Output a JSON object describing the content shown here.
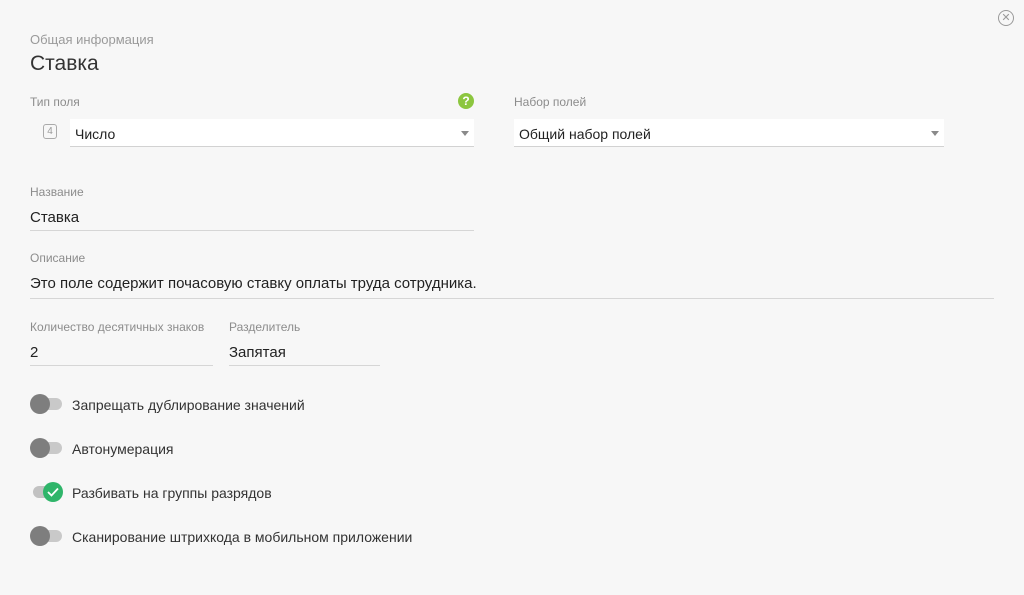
{
  "header": {
    "section_label": "Общая информация",
    "title": "Ставка"
  },
  "icons": {
    "close": "close-icon",
    "help": "help-icon",
    "field_type": "number-type-icon",
    "help_glyph": "?",
    "field_type_glyph": "4",
    "close_glyph": "✕"
  },
  "colors": {
    "accent_green": "#2fb56a",
    "help_green": "#8cc63f"
  },
  "field_type": {
    "label": "Тип поля",
    "value": "Число"
  },
  "field_set": {
    "label": "Набор полей",
    "value": "Общий набор полей"
  },
  "name": {
    "label": "Название",
    "value": "Ставка"
  },
  "description": {
    "label": "Описание",
    "value": "Это поле содержит почасовую ставку оплаты труда сотрудника."
  },
  "decimals": {
    "label": "Количество десятичных знаков",
    "value": "2"
  },
  "separator": {
    "label": "Разделитель",
    "value": "Запятая"
  },
  "toggles": [
    {
      "label": "Запрещать дублирование значений",
      "on": false
    },
    {
      "label": "Автонумерация",
      "on": false
    },
    {
      "label": "Разбивать на группы разрядов",
      "on": true
    },
    {
      "label": "Сканирование штрихкода в мобильном приложении",
      "on": false
    }
  ]
}
